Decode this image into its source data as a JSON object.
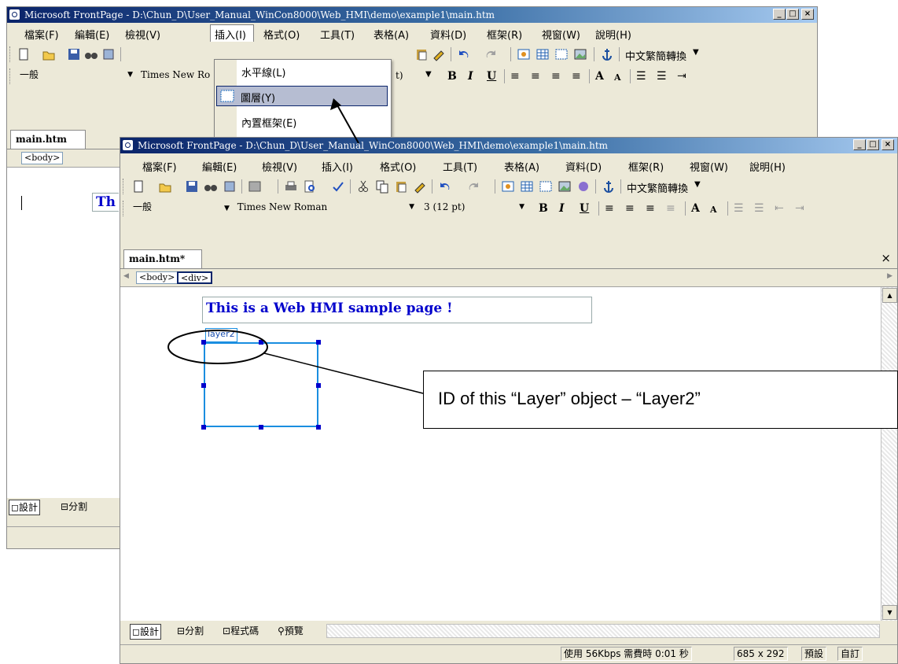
{
  "back_window": {
    "title": "Microsoft FrontPage - D:\\Chun_D\\User_Manual_WinCon8000\\Web_HMI\\demo\\example1\\main.htm",
    "menu": [
      "檔案(F)",
      "編輯(E)",
      "檢視(V)",
      "插入(I)",
      "格式(O)",
      "工具(T)",
      "表格(A)",
      "資料(D)",
      "框架(R)",
      "視窗(W)",
      "說明(H)"
    ],
    "convert_label": "中文繁簡轉換",
    "style_value": "一般",
    "font_value": "Times New Ro",
    "size_tail": "t)",
    "tab_label": "main.htm",
    "crumb_body": "<body>",
    "text_fragment": "Th",
    "view_tabs": [
      "設計",
      "分割"
    ]
  },
  "insert_menu": {
    "items": [
      "水平線(L)",
      "圖層(Y)",
      "內置框架(E)"
    ]
  },
  "front_window": {
    "title": "Microsoft FrontPage - D:\\Chun_D\\User_Manual_WinCon8000\\Web_HMI\\demo\\example1\\main.htm",
    "menu": [
      "檔案(F)",
      "編輯(E)",
      "檢視(V)",
      "插入(I)",
      "格式(O)",
      "工具(T)",
      "表格(A)",
      "資料(D)",
      "框架(R)",
      "視窗(W)",
      "說明(H)"
    ],
    "convert_label": "中文繁簡轉換",
    "style_value": "一般",
    "font_value": "Times New Roman",
    "size_value": "3  (12 pt)",
    "tab_label": "main.htm*",
    "close_glyph": "×",
    "crumbs": [
      "<body>",
      "<div>"
    ],
    "page_text": "This is a Web HMI sample page !",
    "layer_label": "layer2",
    "view_tabs": [
      "設計",
      "分割",
      "程式碼",
      "預覽"
    ],
    "status": {
      "speed": "使用 56Kbps 需費時 0:01 秒",
      "dims": "685 x 292",
      "preset": "預設",
      "custom": "自訂"
    }
  },
  "callout": {
    "text": "ID of this “Layer” object – “Layer2”"
  },
  "colors": {
    "title_blue": "#0a246a",
    "menu_highlight": "#b6bdd2",
    "text_blue": "#0000cc",
    "layer_border": "#1a8ee0",
    "handle": "#0000cc"
  }
}
